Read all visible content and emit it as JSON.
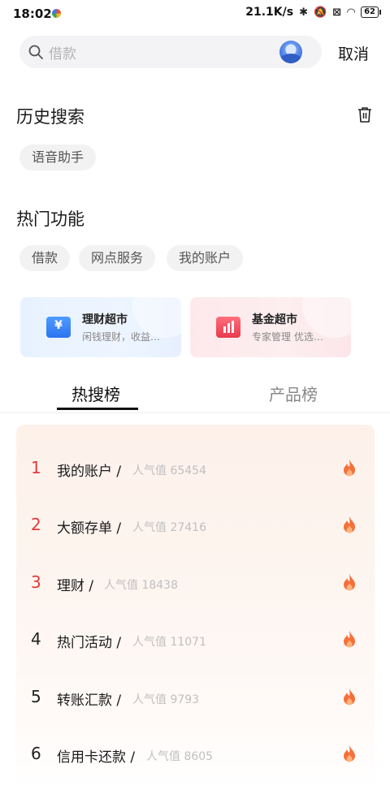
{
  "status_bar": {
    "time": "18:02",
    "speed": "21.1K/s",
    "battery": "62"
  },
  "search": {
    "placeholder": "借款",
    "cancel_label": "取消"
  },
  "history": {
    "title": "历史搜索",
    "items": [
      "语音助手"
    ]
  },
  "hot_functions": {
    "title": "热门功能",
    "items": [
      "借款",
      "网点服务",
      "我的账户"
    ]
  },
  "cards": [
    {
      "title": "理财超市",
      "subtitle": "闲钱理财，收益…",
      "icon": "yen-icon",
      "accent": "#2d74f0"
    },
    {
      "title": "基金超市",
      "subtitle": "专家管理 优选…",
      "icon": "bar-chart-icon",
      "accent": "#e9394d"
    }
  ],
  "tabs": {
    "active": "热搜榜",
    "inactive": "产品榜"
  },
  "ranking": [
    {
      "rank": "1",
      "name": "我的账户 /",
      "popularity": "人气值 65454"
    },
    {
      "rank": "2",
      "name": "大额存单 /",
      "popularity": "人气值 27416"
    },
    {
      "rank": "3",
      "name": "理财 /",
      "popularity": "人气值 18438"
    },
    {
      "rank": "4",
      "name": "热门活动 /",
      "popularity": "人气值 11071"
    },
    {
      "rank": "5",
      "name": "转账汇款 /",
      "popularity": "人气值 9793"
    },
    {
      "rank": "6",
      "name": "信用卡还款 /",
      "popularity": "人气值 8605"
    }
  ],
  "colors": {
    "hot_rank": "#e43a3a",
    "fire": "#f5703a"
  }
}
